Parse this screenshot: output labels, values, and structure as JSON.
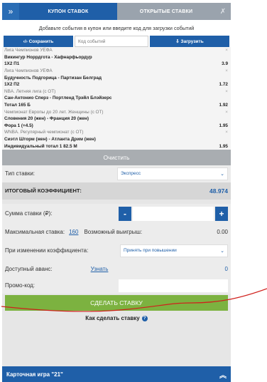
{
  "tabs": {
    "collapse_icon": "»",
    "coupon": "КУПОН СТАВОК",
    "open_bets": "ОТКРЫТЫЕ СТАВКИ",
    "pin_icon": "✗"
  },
  "hint": "Добавьте события в купон или введите код для загрузки событий",
  "toolbar": {
    "save_label": "‹/› Сохранить",
    "code_placeholder": "Код событий",
    "load_label": "⇩ Загрузить"
  },
  "events": [
    {
      "league": "Лига Чемпионов УЕФА",
      "match": "Викингур Норрдгота - Хафнарфьордур",
      "bet": "1X2 П1",
      "odd": "3.9"
    },
    {
      "league": "Лига Чемпионов УЕФА",
      "match": "Будучность Подгорица - Партизан Белград",
      "bet": "1X2 П2",
      "odd": "1.72"
    },
    {
      "league": "NBA. Летняя лига (с ОТ)",
      "match": "Сан-Антонио Сперз - Портленд Трэйл Блэйзерс",
      "bet": "Тотал 165 Б",
      "odd": "1.92"
    },
    {
      "league": "Чемпионат Европы до 20 лет. Женщины (с ОТ)",
      "match": "Словения 20 (жен) - Франция 20 (жен)",
      "bet": "Фора 1 (+4.5)",
      "odd": "1.95"
    },
    {
      "league": "WNBA. Регулярный чемпионат (с ОТ)",
      "match": "Сиэтл Шторм (жен) - Атланта Дрим (жен)",
      "bet": "Индивидуальный тотал 1 82.5 М",
      "odd": "1.95"
    }
  ],
  "clear_label": "Очистить",
  "bet_type": {
    "label": "Тип ставки:",
    "value": "Экспресс"
  },
  "total": {
    "label": "ИТОГОВЫЙ КОЭФФИЦИЕНТ:",
    "value": "48.974"
  },
  "stake": {
    "label": "Сумма ставки (₽):",
    "minus": "-",
    "plus": "+"
  },
  "max": {
    "label": "Максимальная ставка:",
    "value": "160",
    "possible_label": "Возможный выигрыш:",
    "possible_value": "0.00"
  },
  "change": {
    "label": "При изменении коэффициента:",
    "value": "Принять при повышении"
  },
  "advance": {
    "label": "Доступный аванс:",
    "link": "Узнать",
    "value": "0"
  },
  "promo": {
    "label": "Промо-код:"
  },
  "make_bet": "СДЕЛАТЬ СТАВКУ",
  "howto": {
    "label": "Как сделать ставку",
    "icon": "?"
  },
  "game": {
    "label": "Карточная игра \"21\"",
    "icon": "︽"
  },
  "colors": {
    "accent": "#1f5fa8",
    "green": "#7cb240",
    "annotation": "#d0201c"
  }
}
